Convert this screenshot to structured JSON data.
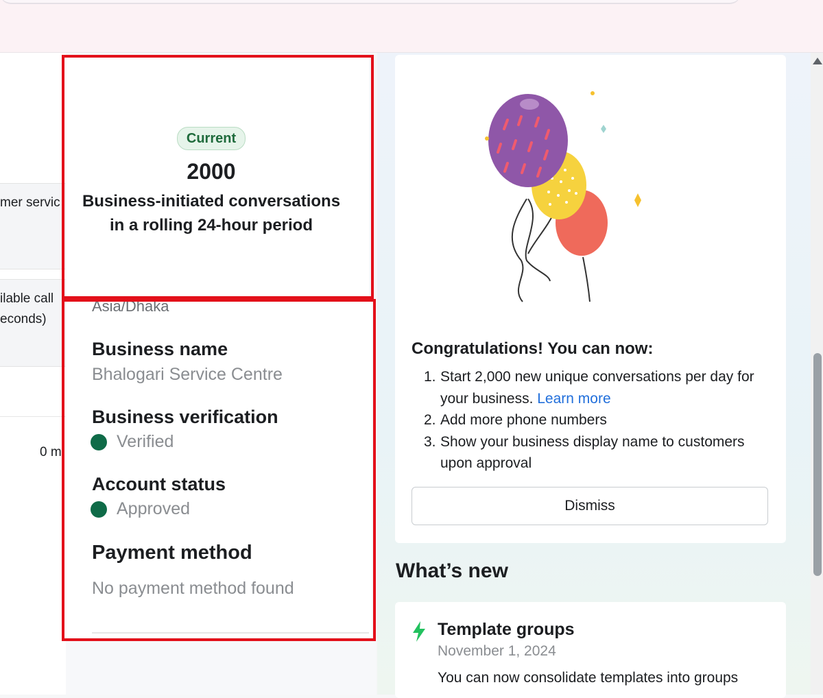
{
  "left_column": {
    "cut_text_1": "mer servic",
    "cut_text_2": "ilable call",
    "cut_text_3": "econds)",
    "cut_text_4": "0 m"
  },
  "tier_card": {
    "badge": "Current",
    "limit_number": "2000",
    "description_line1": "Business-initiated conversations",
    "description_line2": "in a rolling 24-hour period"
  },
  "business_info": {
    "timezone": "Asia/Dhaka",
    "name_label": "Business name",
    "name_value": "Bhalogari Service Centre",
    "verification_label": "Business verification",
    "verification_value": "Verified",
    "account_status_label": "Account status",
    "account_status_value": "Approved",
    "payment_label": "Payment method",
    "payment_value": "No payment method found",
    "status_color": "#0f6b48"
  },
  "congrats": {
    "title": "Congratulations! You can now:",
    "items": [
      {
        "num": "1.",
        "text": "Start 2,000 new unique conversations per day for your business.",
        "link": "Learn more"
      },
      {
        "num": "2.",
        "text": "Add more phone numbers"
      },
      {
        "num": "3.",
        "text": "Show your business display name to customers upon approval"
      }
    ],
    "dismiss_label": "Dismiss",
    "illustration": "balloons-illustration"
  },
  "whats_new": {
    "heading": "What’s new",
    "items": [
      {
        "icon": "lightning-bolt-icon",
        "title": "Template groups",
        "date": "November 1, 2024",
        "body": "You can now consolidate templates into groups"
      }
    ]
  },
  "colors": {
    "highlight_border": "#e3101a",
    "link": "#216fdb",
    "badge_text": "#1f6b3c"
  }
}
